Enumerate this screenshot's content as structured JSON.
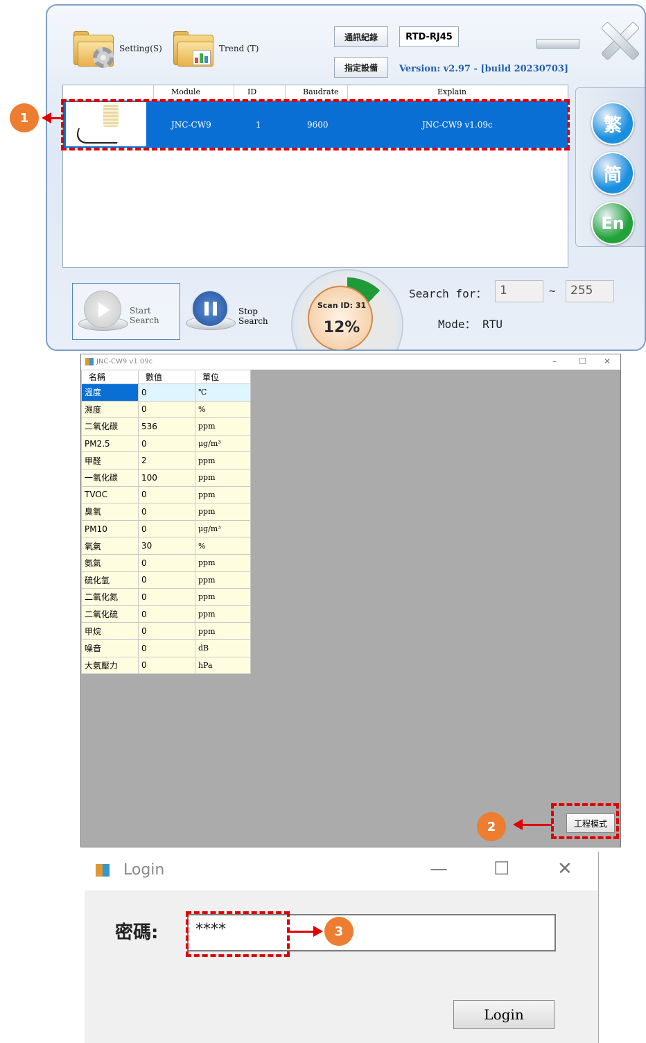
{
  "scanner": {
    "setting_label": "Setting(S)",
    "trend_label": "Trend (T)",
    "comm_log_button": "通訊紀錄",
    "assign_device_button": "指定設備",
    "connection": "RTD-RJ45",
    "version": "Version: v2.97 - [build 20230703]",
    "columns": [
      "Module",
      "ID",
      "Baudrate",
      "Explain"
    ],
    "rows": [
      {
        "module": "JNC-CW9",
        "id": "1",
        "baudrate": "9600",
        "explain": "JNC-CW9  v1.09c"
      }
    ],
    "lang_buttons": [
      {
        "label": "繁",
        "color": "#1a8fe0"
      },
      {
        "label": "简",
        "color": "#1a8fe0"
      },
      {
        "label": "En",
        "color": "#22a33a"
      }
    ],
    "start_search": "Start Search",
    "stop_search": "Stop Search",
    "scan_id": "Scan ID: 31",
    "progress_percent": "12%",
    "progress_value": 0.12,
    "search_for_label": "Search for：",
    "search_from": "1",
    "search_tilde": "~",
    "search_to": "255",
    "mode_label": "Mode： RTU"
  },
  "callouts": {
    "one": "1",
    "two": "2",
    "three": "3"
  },
  "data_window": {
    "title": "JNC-CW9  v1.09c",
    "headers": [
      "名稱",
      "數值",
      "單位"
    ],
    "rows": [
      [
        "溫度",
        "0",
        "℃"
      ],
      [
        "濕度",
        "0",
        "%"
      ],
      [
        "二氧化碳",
        "536",
        "ppm"
      ],
      [
        "PM2.5",
        "0",
        "μg/m³"
      ],
      [
        "甲醛",
        "2",
        "ppm"
      ],
      [
        "一氧化碳",
        "100",
        "ppm"
      ],
      [
        "TVOC",
        "0",
        "ppm"
      ],
      [
        "臭氧",
        "0",
        "ppm"
      ],
      [
        "PM10",
        "0",
        "μg/m³"
      ],
      [
        "氧氣",
        "30",
        "%"
      ],
      [
        "氨氣",
        "0",
        "ppm"
      ],
      [
        "硫化氫",
        "0",
        "ppm"
      ],
      [
        "二氧化氮",
        "0",
        "ppm"
      ],
      [
        "二氧化硫",
        "0",
        "ppm"
      ],
      [
        "甲烷",
        "0",
        "ppm"
      ],
      [
        "噪音",
        "0",
        "dB"
      ],
      [
        "大氣壓力",
        "0",
        "hPa"
      ]
    ],
    "engineer_button": "工程模式"
  },
  "login": {
    "title": "Login",
    "password_label": "密碼:",
    "password_value": "****",
    "login_button": "Login"
  }
}
